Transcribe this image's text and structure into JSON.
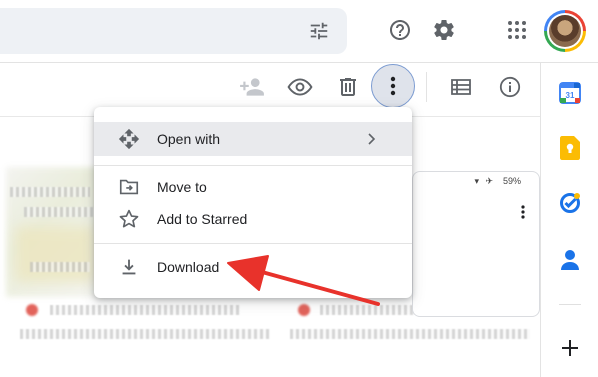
{
  "header": {
    "search_filter_icon": "tune-icon",
    "help_icon": "help-circle-icon",
    "settings_icon": "gear-icon",
    "apps_icon": "apps-grid-icon",
    "avatar": "account-avatar"
  },
  "toolbar": {
    "icons": [
      "person-add-icon",
      "eye-icon",
      "trash-icon",
      "more-vert-icon",
      "list-view-icon",
      "info-icon"
    ]
  },
  "menu": {
    "items": [
      {
        "label": "Open with",
        "icon": "open-with-icon",
        "has_submenu": true
      },
      {
        "label": "Move to",
        "icon": "drive-file-move-icon"
      },
      {
        "label": "Add to Starred",
        "icon": "star-icon"
      },
      {
        "label": "Download",
        "icon": "download-icon"
      }
    ]
  },
  "side_panel": {
    "apps": [
      "calendar-icon",
      "keep-icon",
      "tasks-icon",
      "contacts-icon",
      "add-icon"
    ],
    "calendar_day": "31"
  },
  "preview": {
    "battery": "59%"
  },
  "colors": {
    "arrow": "#e8322b",
    "more_button_bg": "#dfe3eb",
    "highlight_row": "#e9eaed",
    "search_bg": "#eef1f5"
  }
}
